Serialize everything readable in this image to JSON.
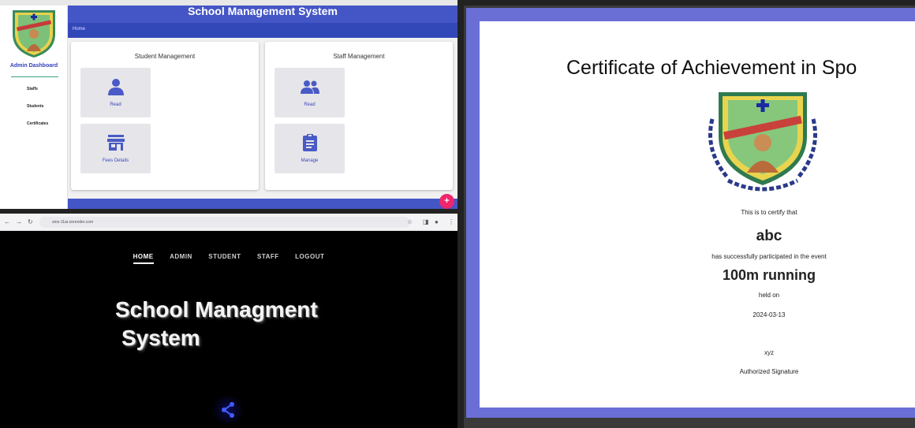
{
  "dashboard": {
    "header_title": "School Management System",
    "breadcrumb": "Home",
    "sidebar": {
      "title": "Admin Dashboard",
      "items": [
        {
          "label": "Staffs"
        },
        {
          "label": "Students"
        },
        {
          "label": "Certificates"
        }
      ]
    },
    "student_card": {
      "title": "Student Management",
      "tiles": [
        {
          "label": "Read",
          "icon": "person-icon"
        },
        {
          "label": "Fees Details",
          "icon": "store-icon"
        }
      ]
    },
    "staff_card": {
      "title": "Staff Management",
      "tiles": [
        {
          "label": "Read",
          "icon": "group-icon"
        },
        {
          "label": "Manage",
          "icon": "clipboard-icon"
        }
      ]
    },
    "fab_label": "+",
    "accent_color": "#4456c6",
    "fab_color": "#f0266c"
  },
  "landing": {
    "url": "sms-11ar.onrender.com",
    "menu": [
      {
        "label": "HOME"
      },
      {
        "label": "ADMIN"
      },
      {
        "label": "STUDENT"
      },
      {
        "label": "STAFF"
      },
      {
        "label": "LOGOUT"
      }
    ],
    "hero_line1": "School Managment",
    "hero_line2": "System",
    "share_icon": "share-icon"
  },
  "certificate": {
    "title": "Certificate of Achievement in Spo",
    "certify_text": "This is to certify that",
    "name": "abc",
    "participation_text": "has successfully participated in the event",
    "event": "100m running",
    "held_on_text": "held on",
    "date": "2024-03-13",
    "signature": "xyz",
    "signature_label": "Authorized Signature",
    "frame_color": "#6a6fd6"
  }
}
